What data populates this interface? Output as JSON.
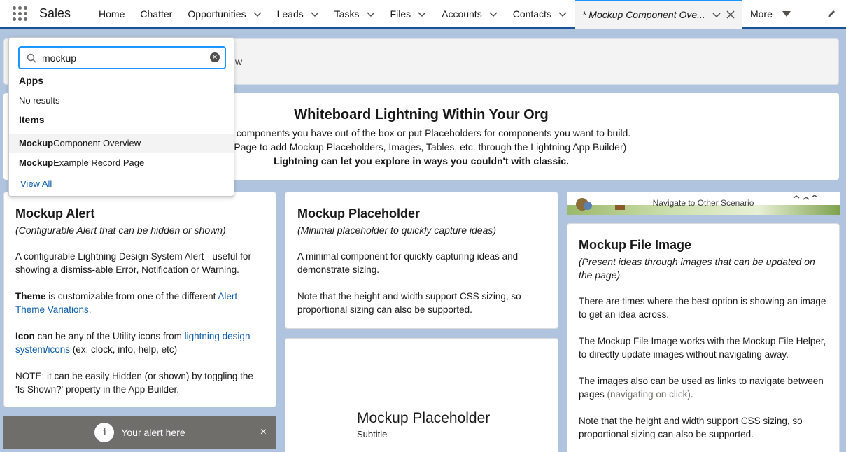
{
  "nav": {
    "app_name": "Sales",
    "items": [
      "Home",
      "Chatter",
      "Opportunities",
      "Leads",
      "Tasks",
      "Files",
      "Accounts",
      "Contacts"
    ],
    "active_tab": "* Mockup Component Ove...",
    "more": "More"
  },
  "header_stub": "w",
  "hero": {
    "title": "Whiteboard Lightning Within Your Org",
    "line1": "g the components you have out of the box or put Placeholders for components you want to build.",
    "line2": "this Page to add Mockup Placeholders, Images, Tables, etc. through the Lightning App Builder)",
    "line3": "Lightning can let you explore in ways you couldn't with classic."
  },
  "alert_card": {
    "title": "Mockup Alert",
    "subtitle": "(Configurable Alert that can be hidden or shown)",
    "p1": "A configurable Lightning Design System Alert - useful for showing a dismiss-able Error, Notification or Warning.",
    "p2_bold": "Theme",
    "p2_text": " is customizable from one of the different ",
    "p2_link": "Alert Theme Variations",
    "p2_end": ".",
    "p3_bold": "Icon",
    "p3_text": " can be any of the Utility icons from ",
    "p3_link": "lightning design system/icons",
    "p3_end": " (ex: clock, info, help, etc)",
    "p4": "NOTE: it can be easily Hidden (or shown) by toggling the 'Is Shown?' property in the App Builder."
  },
  "alert_bar": {
    "text": "Your alert here",
    "info": "i",
    "close": "×"
  },
  "placeholder_card": {
    "title": "Mockup Placeholder",
    "subtitle": "(Minimal placeholder to quickly capture ideas)",
    "p1": "A minimal component for quickly capturing ideas and demonstrate sizing.",
    "p2": "Note that the height and width support CSS sizing, so proportional sizing can also be supported."
  },
  "placeholder_box": {
    "title": "Mockup Placeholder",
    "subtitle": "Subtitle"
  },
  "banner": {
    "text": "Navigate to Other Scenario"
  },
  "file_image_card": {
    "title": "Mockup File Image",
    "subtitle": "(Present ideas through images that can be updated on the page)",
    "p1": "There are times where the best option is showing an image to get an idea across.",
    "p2": "The Mockup File Image works with the Mockup File Helper, to directly update images without navigating away.",
    "p3_text": "The images also can be used as links to navigate between pages ",
    "p3_link": "(navigating on click)",
    "p3_end": ".",
    "p4": "Note that the height and width support CSS sizing, so proportional sizing can also be supported."
  },
  "search": {
    "value": "mockup",
    "apps_header": "Apps",
    "no_results": "No results",
    "items_header": "Items",
    "results": [
      {
        "bold": "Mockup",
        "rest": " Component Overview"
      },
      {
        "bold": "Mockup",
        "rest": " Example Record Page"
      }
    ],
    "view_all": "View All"
  }
}
